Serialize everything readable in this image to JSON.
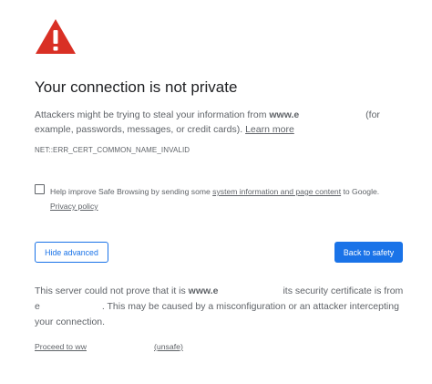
{
  "icons": {
    "warning": "warning-triangle-icon"
  },
  "colors": {
    "warning_red": "#d93025",
    "primary_blue": "#1a73e8",
    "text_gray": "#5f6368",
    "title_dark": "#202124"
  },
  "page": {
    "title": "Your connection is not private",
    "desc_prefix": "Attackers might be trying to steal your information from ",
    "desc_domain": "www.e",
    "desc_middle": " (for example, passwords, messages, or credit cards). ",
    "learn_more": "Learn more",
    "error_code": "NET::ERR_CERT_COMMON_NAME_INVALID"
  },
  "safe_browsing": {
    "text_prefix": "Help improve Safe Browsing by sending some ",
    "link_text": "system information and page content",
    "text_suffix": " to Google.",
    "privacy_link": "Privacy policy"
  },
  "buttons": {
    "hide_advanced": "Hide advanced",
    "back_to_safety": "Back to safety"
  },
  "details": {
    "prefix": "This server could not prove that it is ",
    "domain": "www.e",
    "middle": " its security certificate is from ",
    "domain2": "e",
    "suffix": ". This may be caused by a misconfiguration or an attacker intercepting your connection."
  },
  "proceed": {
    "prefix": "Proceed to ww",
    "suffix": "(unsafe)"
  }
}
